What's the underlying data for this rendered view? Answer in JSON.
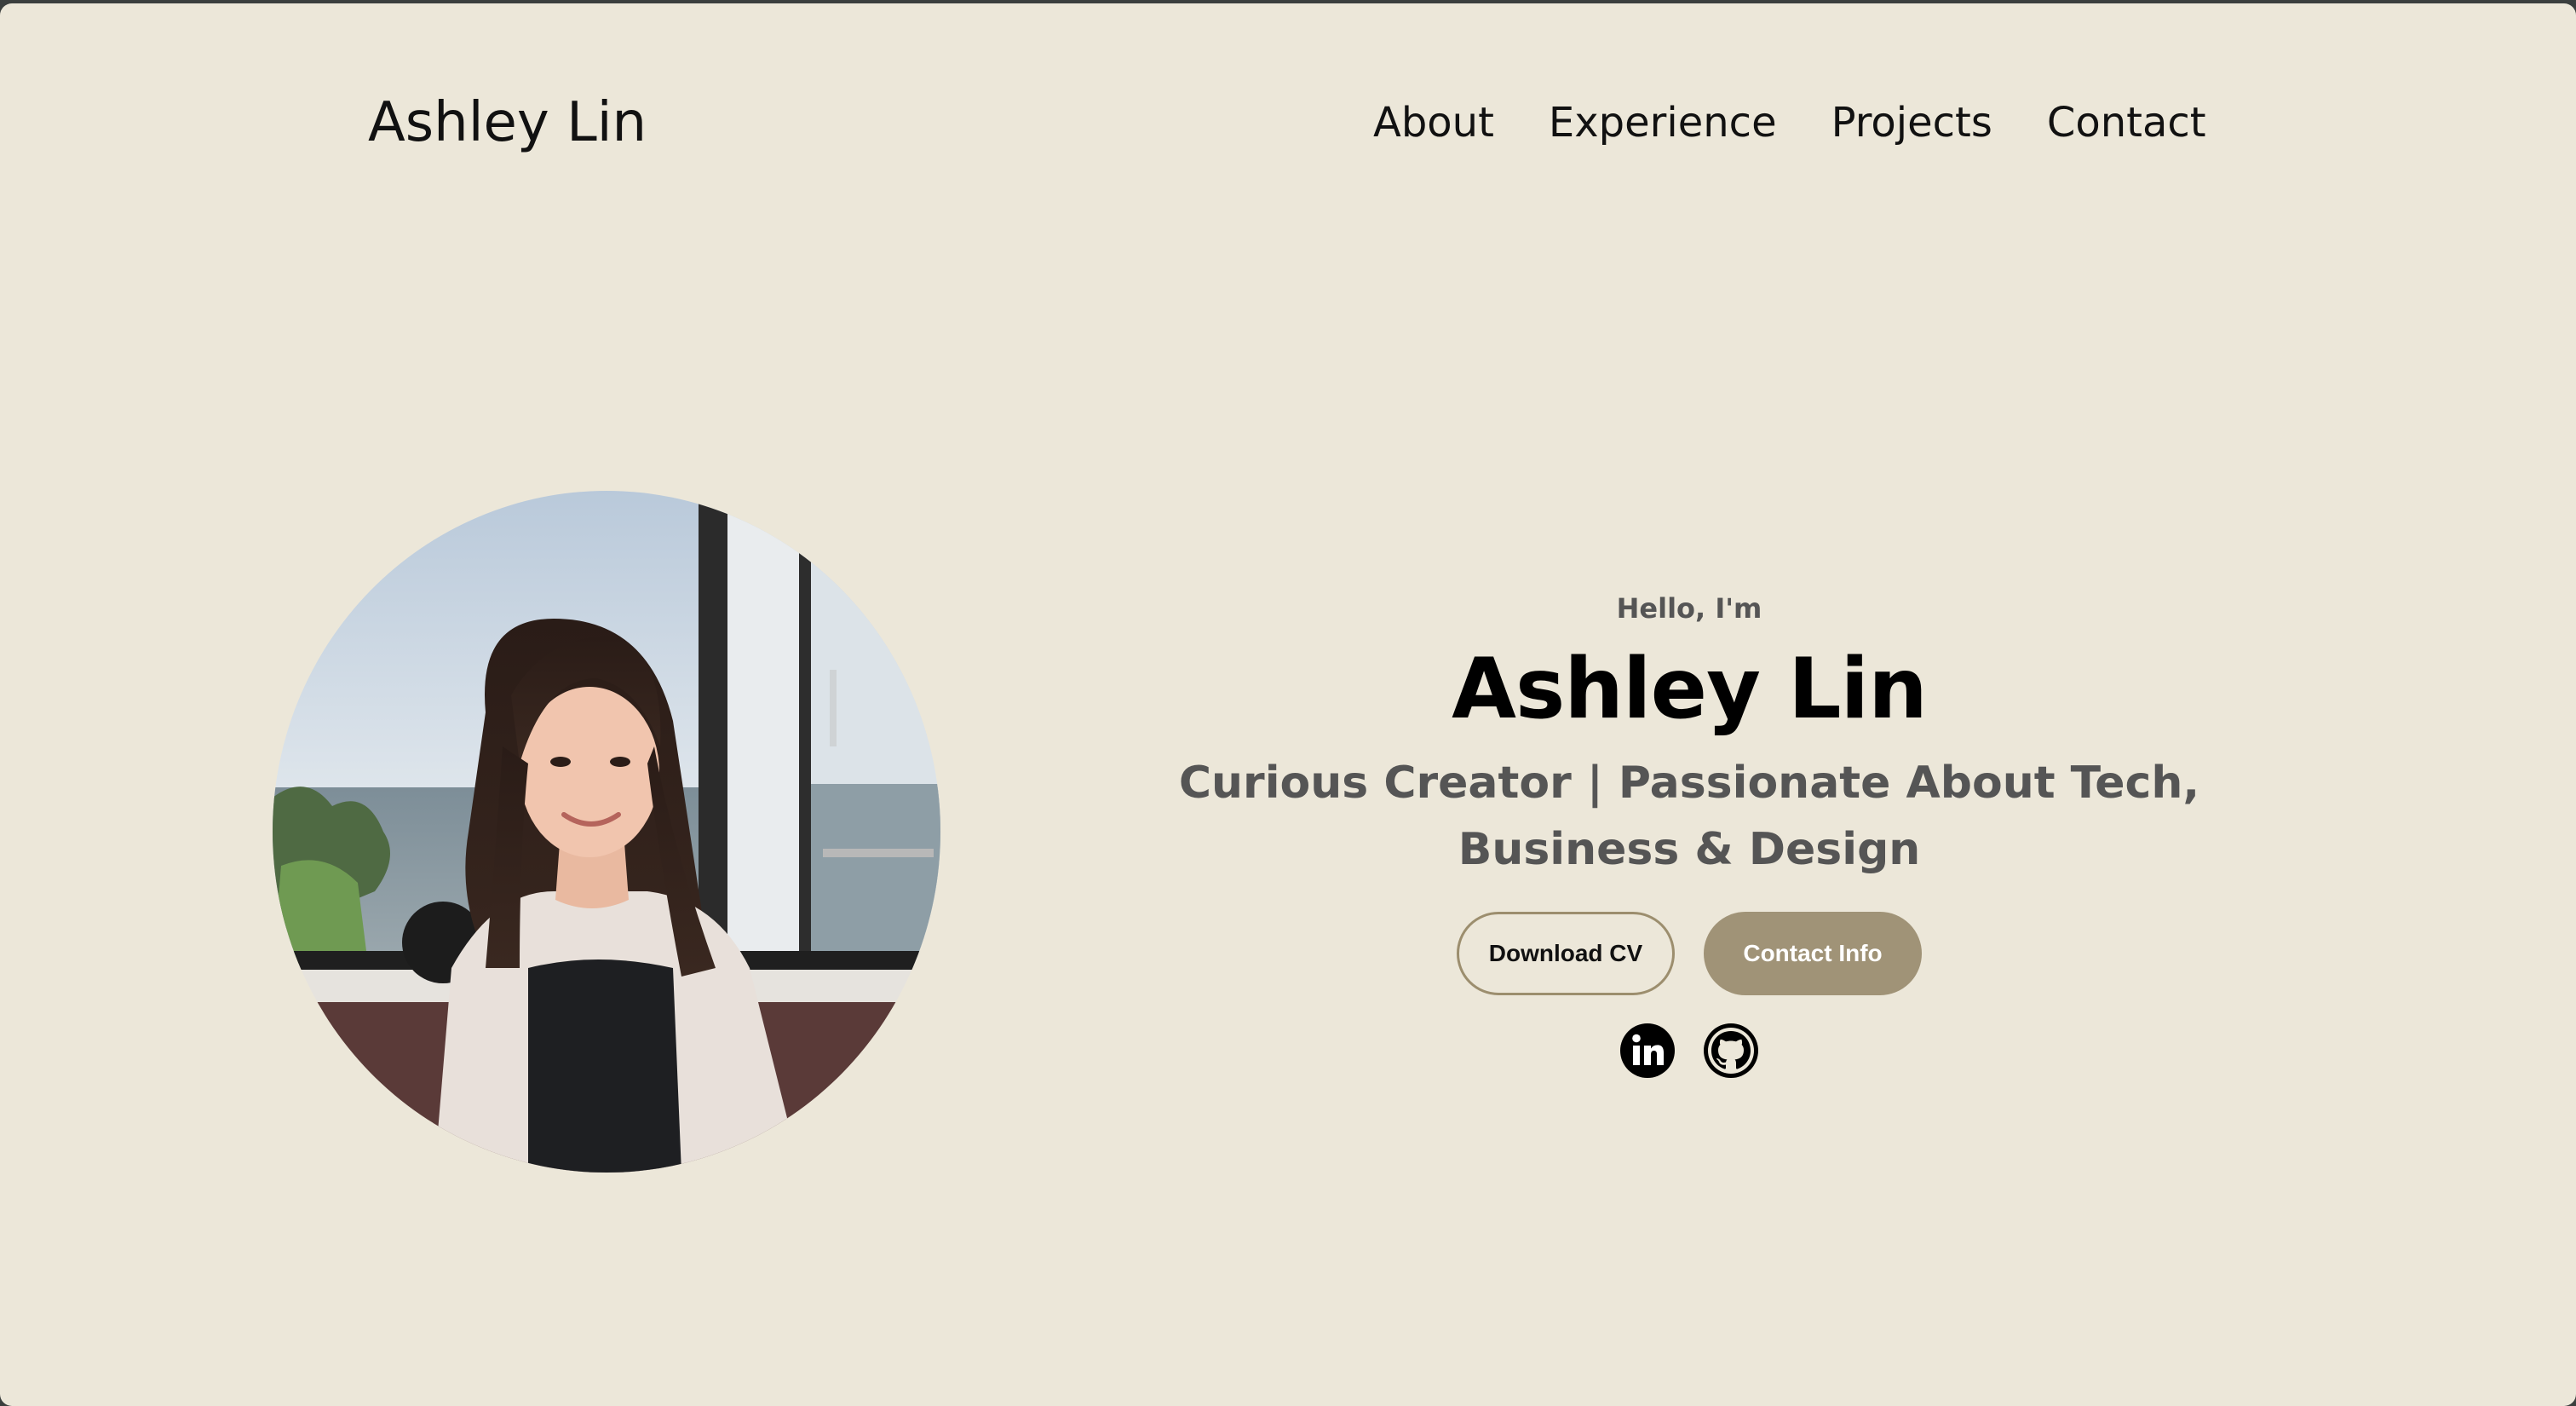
{
  "header": {
    "logo": "Ashley Lin",
    "nav": [
      {
        "label": "About"
      },
      {
        "label": "Experience"
      },
      {
        "label": "Projects"
      },
      {
        "label": "Contact"
      }
    ]
  },
  "hero": {
    "greeting": "Hello, I'm",
    "name": "Ashley Lin",
    "tagline": "Curious Creator | Passionate About Tech, Business & Design",
    "buttons": {
      "download_cv": "Download CV",
      "contact_info": "Contact Info"
    },
    "socials": [
      {
        "icon": "linkedin-icon"
      },
      {
        "icon": "github-icon"
      }
    ]
  },
  "colors": {
    "background": "#ece7d9",
    "accent": "#a09377",
    "text": "#111111",
    "muted_text": "#555555"
  }
}
